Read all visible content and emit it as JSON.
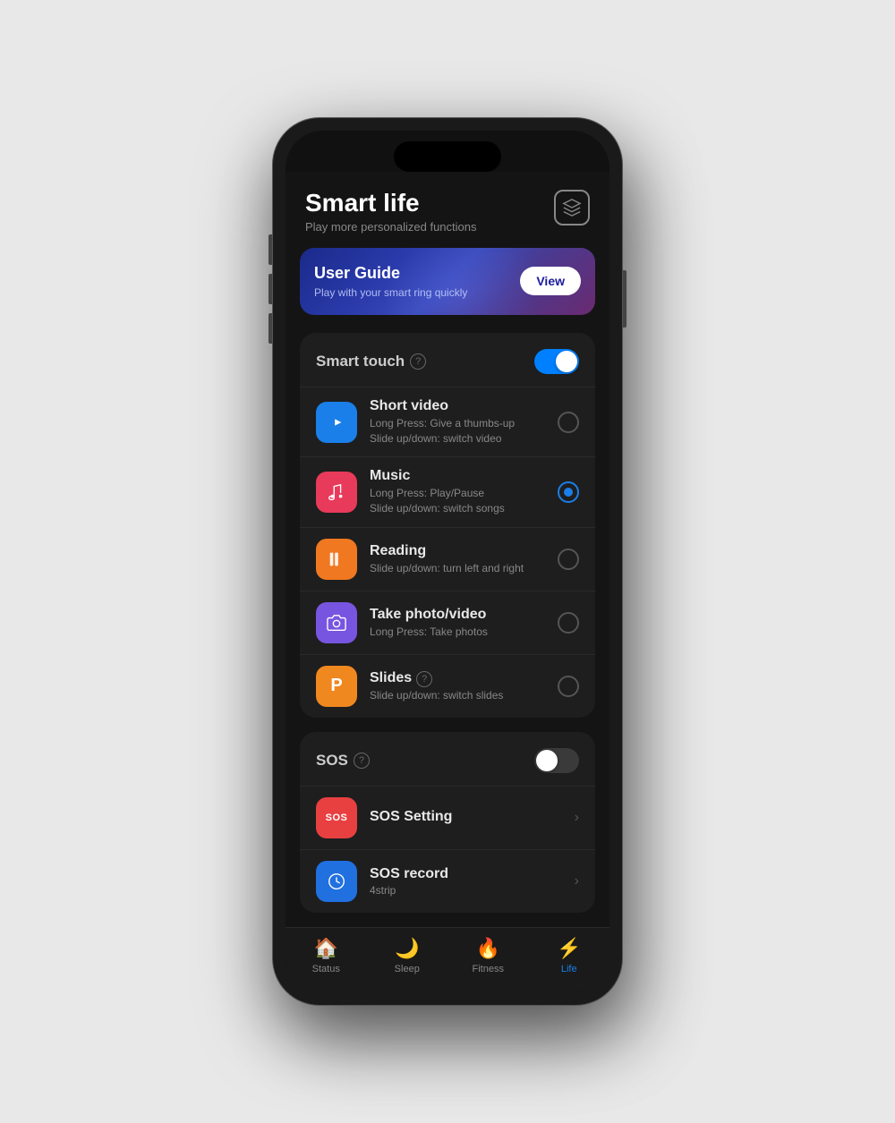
{
  "app": {
    "title": "Smart life",
    "subtitle": "Play more personalized functions",
    "cube_icon_label": "cube-icon"
  },
  "banner": {
    "title": "User Guide",
    "subtitle": "Play with your smart ring quickly",
    "button_label": "View"
  },
  "smart_touch": {
    "title": "Smart touch",
    "toggle_state": "on",
    "items": [
      {
        "name": "Short video",
        "desc_line1": "Long Press: Give a thumbs-up",
        "desc_line2": "Slide up/down: switch video",
        "icon_class": "blue",
        "icon_symbol": "▶",
        "selected": false
      },
      {
        "name": "Music",
        "desc_line1": "Long Press: Play/Pause",
        "desc_line2": "Slide up/down: switch songs",
        "icon_class": "red",
        "icon_symbol": "♪",
        "selected": true
      },
      {
        "name": "Reading",
        "desc_line1": "Slide up/down: turn left and",
        "desc_line2": "right",
        "icon_class": "orange",
        "icon_symbol": "▐▐",
        "selected": false
      },
      {
        "name": "Take photo/video",
        "desc_line1": "Long Press: Take photos",
        "desc_line2": "",
        "icon_class": "purple",
        "icon_symbol": "📷",
        "selected": false
      },
      {
        "name": "Slides",
        "desc_line1": "Slide up/down: switch slides",
        "desc_line2": "",
        "icon_class": "orange2",
        "icon_symbol": "P",
        "has_help": true,
        "selected": false
      }
    ]
  },
  "sos": {
    "title": "SOS",
    "toggle_state": "off",
    "items": [
      {
        "name": "SOS Setting",
        "desc": "",
        "icon_class": "red-sos",
        "icon_type": "text",
        "icon_text": "SOS"
      },
      {
        "name": "SOS record",
        "desc": "4strip",
        "icon_class": "blue2",
        "icon_type": "symbol",
        "icon_symbol": "🕐"
      }
    ]
  },
  "bottom_nav": [
    {
      "label": "Status",
      "icon": "🏠",
      "active": false
    },
    {
      "label": "Sleep",
      "icon": "🌙",
      "active": false
    },
    {
      "label": "Fitness",
      "icon": "🔥",
      "active": false
    },
    {
      "label": "Life",
      "icon": "⚡",
      "active": true
    }
  ]
}
